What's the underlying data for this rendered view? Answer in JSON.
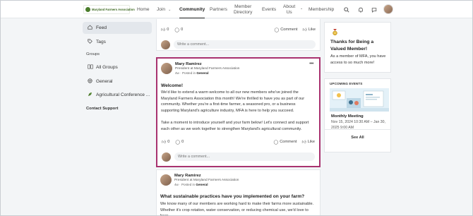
{
  "nav": {
    "logo_text": "Maryland Farmers Association",
    "items": [
      {
        "label": "Home"
      },
      {
        "label": "Join"
      },
      {
        "label": "Community"
      },
      {
        "label": "Partners"
      },
      {
        "label_line1": "Member",
        "label_line2": "Directory"
      },
      {
        "label": "Events"
      },
      {
        "label_line1": "About",
        "label_line2": "Us"
      },
      {
        "label": "Membership"
      }
    ],
    "icons": [
      "search-icon",
      "bell-icon",
      "chat-icon"
    ]
  },
  "sidebar": {
    "feed": "Feed",
    "tags": "Tags",
    "groups_heading": "Groups",
    "groups": [
      "All Groups",
      "General",
      "Agricultural Conference ..."
    ],
    "contact": "Contact Support"
  },
  "feed": {
    "top_card": {
      "likes": "0",
      "comments": "0",
      "comment_label": "Comment",
      "like_label": "Like",
      "comment_placeholder": "Write a comment..."
    },
    "post1": {
      "author": "Mary Ramirez",
      "role": "President at Maryland Farmers Association",
      "age": "4w",
      "posted_in_prefix": "· Posted in",
      "group": "General",
      "title": "Welcome!",
      "paragraph1": "We'd like to extend a warm welcome to all our new members who've joined the Maryland Farmers Association this month! We're thrilled to have you as part of our community. Whether you're a first-time farmer, a seasoned pro, or a business supporting Maryland's agriculture industry, MFA is here to help you succeed.",
      "paragraph2": "Take a moment to introduce yourself and your farm below! Let's connect and support each other as we work together to strengthen Maryland's agricultural community.",
      "likes": "0",
      "comments": "0",
      "comment_label": "Comment",
      "like_label": "Like",
      "comment_placeholder": "Write a comment..."
    },
    "post2": {
      "author": "Mary Ramirez",
      "role": "President at Maryland Farmers Association",
      "age": "4w",
      "posted_in_prefix": "· Posted in",
      "group": "General",
      "title": "What sustainable practices have you implemented on your farm?",
      "paragraph1": "We know many of our members are working hard to make their farms more sustainable. Whether it's crop rotation, water conservation, or reducing chemical use, we'd love to hear"
    }
  },
  "widgets": {
    "badge": {
      "title": "Thanks for Being a Valued Member!",
      "text": "As a member of MFA, you have access to so much more!"
    },
    "events": {
      "heading": "UPCOMING EVENTS",
      "event_title": "Monthly Meeting",
      "event_date": "Nov 15, 2024 10:30 AM – Jan 30, 2025 9:00 AM",
      "see_all": "See All"
    }
  },
  "colors": {
    "highlight_border": "#a8326f",
    "brand_green": "#4a7d2b",
    "active_sidebar": "#e3e7ec"
  }
}
